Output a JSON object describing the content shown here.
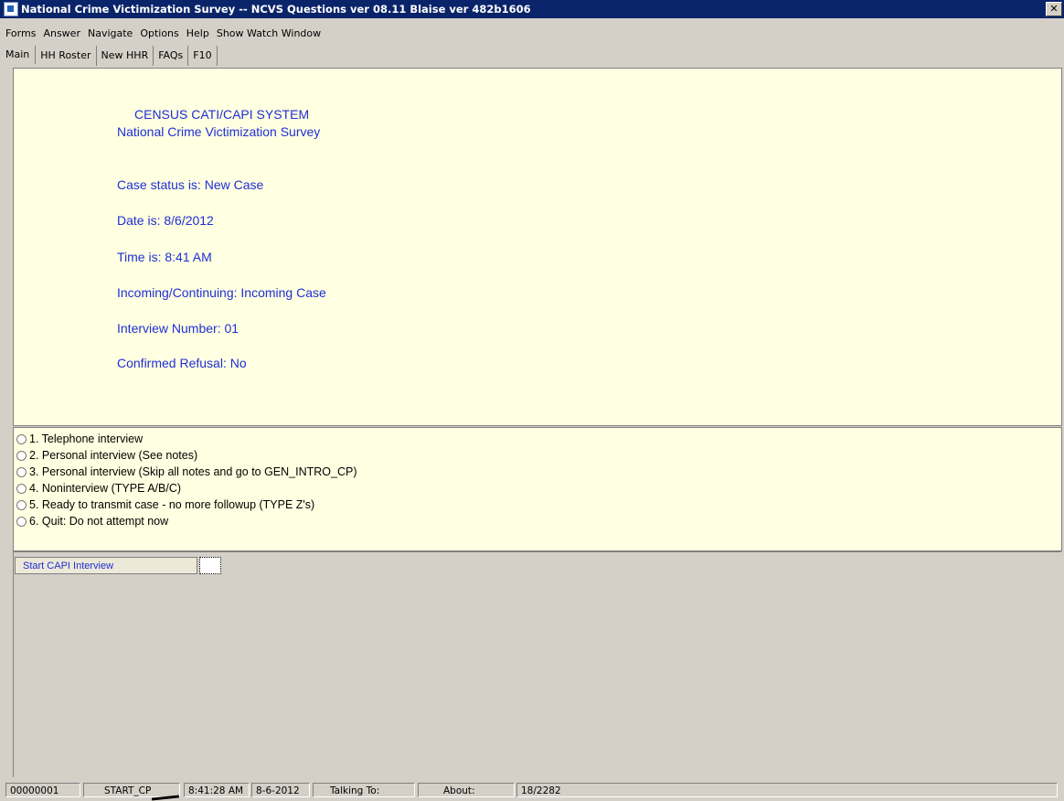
{
  "window": {
    "title": "National Crime Victimization Survey -- NCVS Questions ver 08.11 Blaise ver 482b1606",
    "close_label": "✕"
  },
  "menu": [
    "Forms",
    "Answer",
    "Navigate",
    "Options",
    "Help",
    "Show Watch Window"
  ],
  "tabs": [
    "Main",
    "HH Roster",
    "New HHR",
    "FAQs",
    "F10"
  ],
  "question": {
    "header1": "CENSUS CATI/CAPI SYSTEM",
    "header2": "National Crime Victimization Survey",
    "lines": [
      "Case status is: New Case",
      "Date is: 8/6/2012",
      "Time is: 8:41 AM",
      "Incoming/Continuing: Incoming Case",
      "Interview Number: 01",
      "Confirmed Refusal: No"
    ]
  },
  "answers": [
    "1. Telephone interview",
    "2. Personal interview (See notes)",
    "3. Personal interview (Skip all notes and go to GEN_INTRO_CP)",
    "4. Noninterview (TYPE A/B/C)",
    "5. Ready to transmit case - no more followup (TYPE Z's)",
    "6. Quit: Do not attempt now"
  ],
  "field": {
    "label": "Start CAPI Interview",
    "value": ""
  },
  "status": {
    "case_id": "00000001",
    "field_name": "START_CP",
    "time": "8:41:28 AM",
    "date": "8-6-2012",
    "talking_to": "Talking To:",
    "about": "About:",
    "position": "18/2282"
  }
}
